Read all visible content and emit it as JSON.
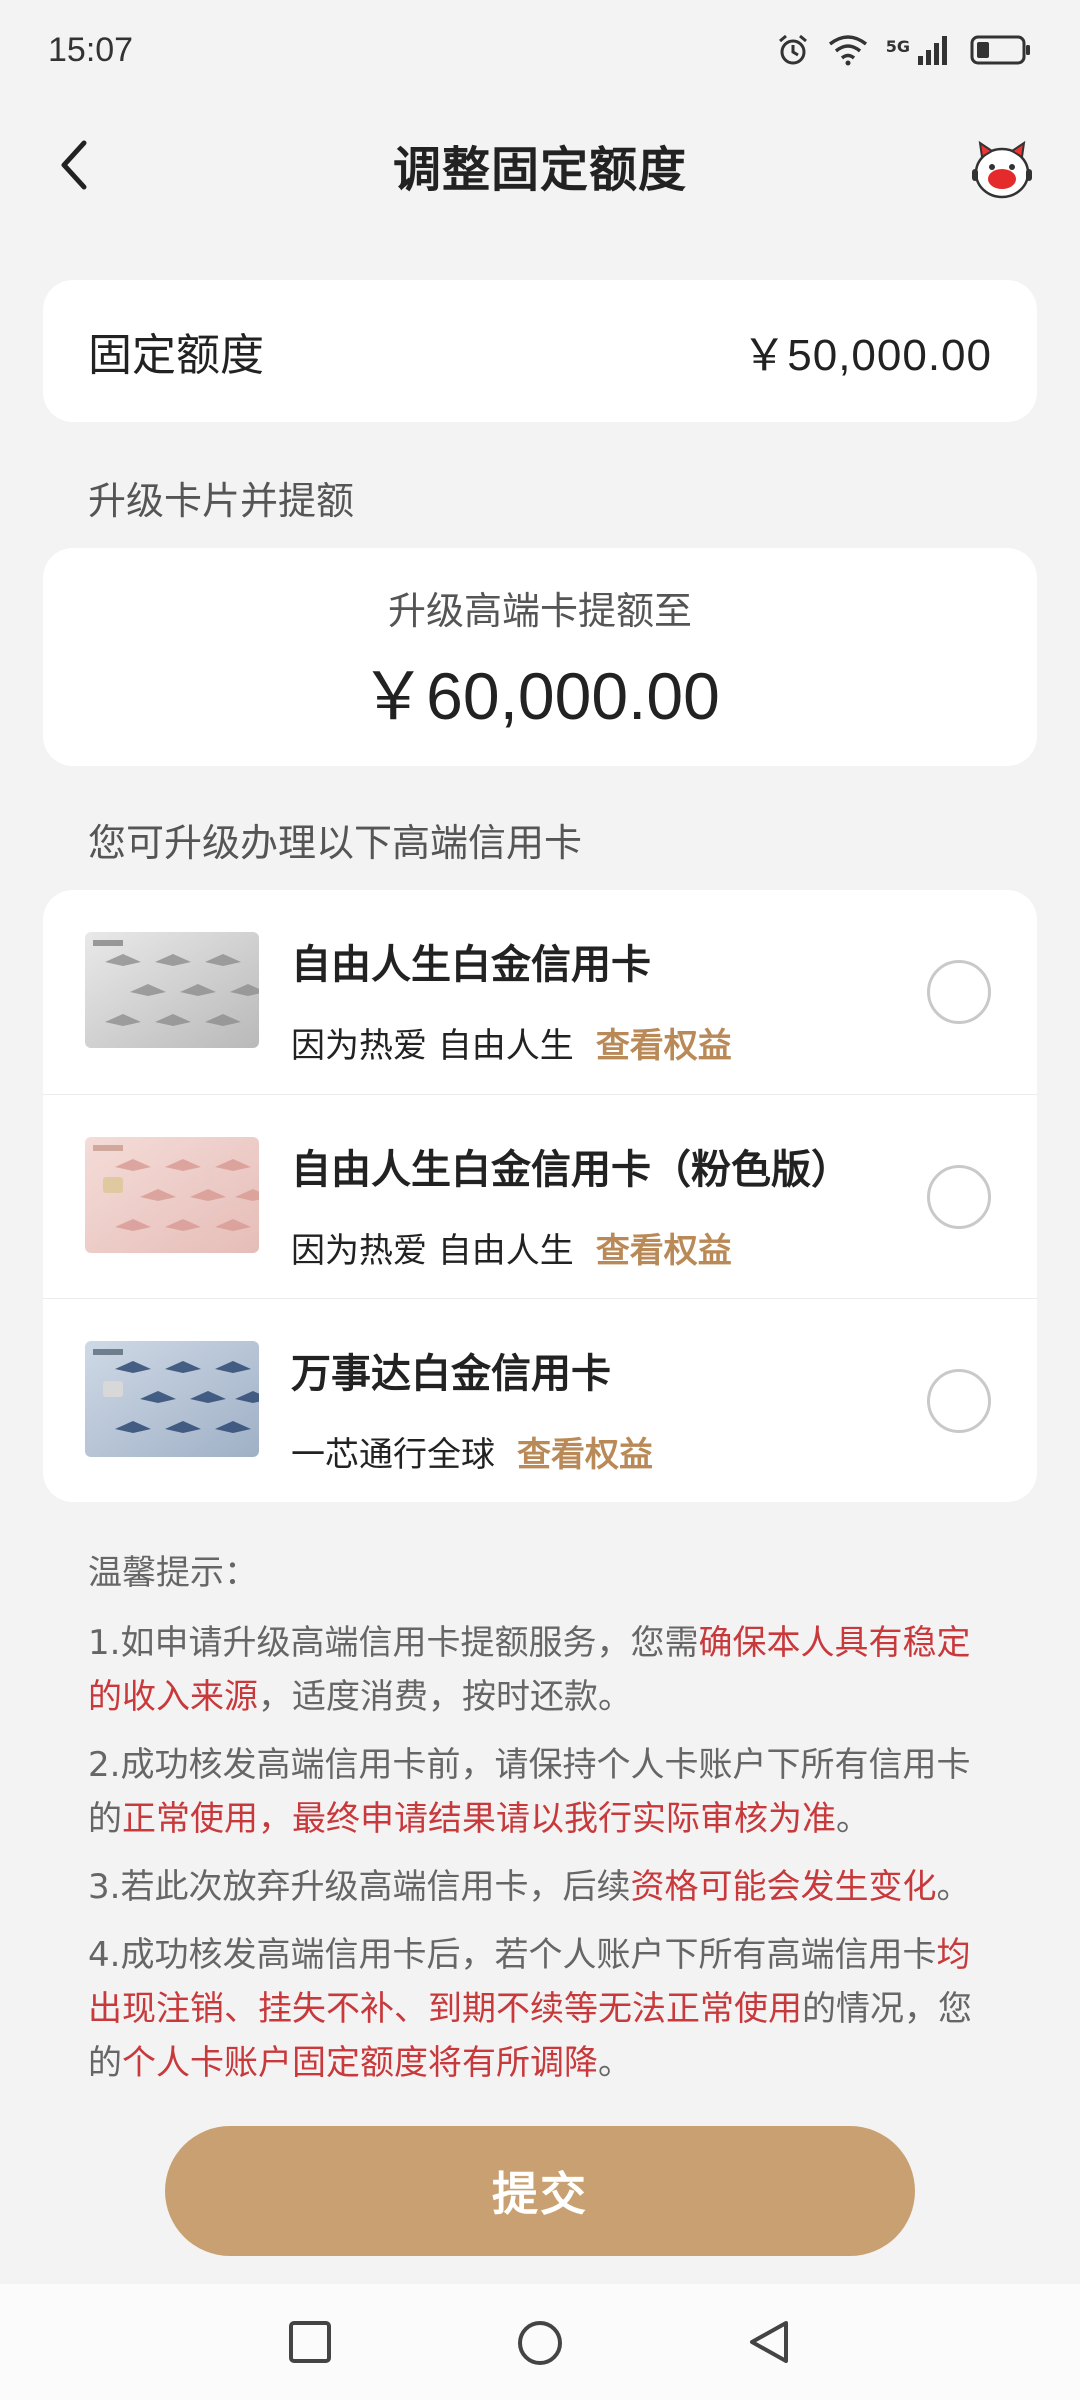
{
  "status_bar": {
    "time": "15:07",
    "network": "5G"
  },
  "nav": {
    "title": "调整固定额度"
  },
  "fixed_limit": {
    "label": "固定额度",
    "value": "￥50,000.00"
  },
  "upgrade_section_title": "升级卡片并提额",
  "upgrade": {
    "subtitle": "升级高端卡提额至",
    "amount": "￥60,000.00"
  },
  "cards_section_title": "您可升级办理以下高端信用卡",
  "cards": [
    {
      "name": "自由人生白金信用卡",
      "slogan": "因为热爱 自由人生",
      "link": "查看权益",
      "selected": false,
      "style": "silver"
    },
    {
      "name": "自由人生白金信用卡（粉色版）",
      "slogan": "因为热爱 自由人生",
      "link": "查看权益",
      "selected": false,
      "style": "pink"
    },
    {
      "name": "万事达白金信用卡",
      "slogan": "一芯通行全球",
      "link": "查看权益",
      "selected": false,
      "style": "blue"
    }
  ],
  "tips": {
    "title": "温馨提示：",
    "items": [
      [
        {
          "t": "1.如申请升级高端信用卡提额服务，您需",
          "hl": false
        },
        {
          "t": "确保本人具有稳定的收入来源",
          "hl": true
        },
        {
          "t": "，适度消费，按时还款。",
          "hl": false
        }
      ],
      [
        {
          "t": "2.成功核发高端信用卡前，请保持个人卡账户下所有信用卡的",
          "hl": false
        },
        {
          "t": "正常使用，最终申请结果请以我行实际审核为准",
          "hl": true
        },
        {
          "t": "。",
          "hl": false
        }
      ],
      [
        {
          "t": "3.若此次放弃升级高端信用卡，后续",
          "hl": false
        },
        {
          "t": "资格可能会发生变化",
          "hl": true
        },
        {
          "t": "。",
          "hl": false
        }
      ],
      [
        {
          "t": "4.成功核发高端信用卡后，若个人账户下所有高端信用卡",
          "hl": false
        },
        {
          "t": "均出现注销、挂失不补、到期不续等无法正常使用",
          "hl": true
        },
        {
          "t": "的情况，您的",
          "hl": false
        },
        {
          "t": "个人卡账户固定额度将有所调降",
          "hl": true
        },
        {
          "t": "。",
          "hl": false
        }
      ]
    ]
  },
  "submit_label": "提交",
  "colors": {
    "accent": "#c9a071",
    "link": "#b98a57",
    "highlight": "#c8393c",
    "background": "#f4f3f3"
  }
}
